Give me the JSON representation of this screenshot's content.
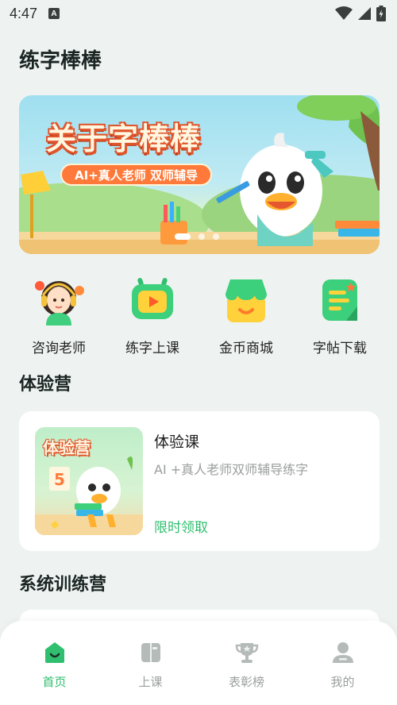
{
  "status_bar": {
    "time": "4:47",
    "notification_icon": "A",
    "icons": [
      "wifi-icon",
      "signal-icon",
      "battery-icon"
    ]
  },
  "page": {
    "title": "练字棒棒"
  },
  "banner": {
    "title": "关于字棒棒",
    "subtitle": "AI+真人老师 双师辅导",
    "slide_count": 3,
    "active_slide": 1
  },
  "quick_entries": [
    {
      "label": "咨询老师",
      "icon": "consult-teacher-icon"
    },
    {
      "label": "练字上课",
      "icon": "tv-play-icon"
    },
    {
      "label": "金币商城",
      "icon": "shop-icon"
    },
    {
      "label": "字帖下载",
      "icon": "copybook-icon"
    }
  ],
  "trial_section": {
    "title": "体验营",
    "card": {
      "thumb_title": "体验营",
      "thumb_number": "5",
      "name": "体验课",
      "description": "AI +真人老师双师辅导练字",
      "cta": "限时领取"
    }
  },
  "system_section": {
    "title": "系统训练营"
  },
  "tab_bar": {
    "tabs": [
      {
        "label": "首页",
        "icon": "home-icon",
        "active": true
      },
      {
        "label": "上课",
        "icon": "book-icon",
        "active": false
      },
      {
        "label": "表彰榜",
        "icon": "trophy-icon",
        "active": false
      },
      {
        "label": "我的",
        "icon": "user-icon",
        "active": false
      }
    ]
  },
  "colors": {
    "accent": "#2fbf6f",
    "background": "#eef3f1",
    "banner_orange": "#ff7a3a"
  }
}
